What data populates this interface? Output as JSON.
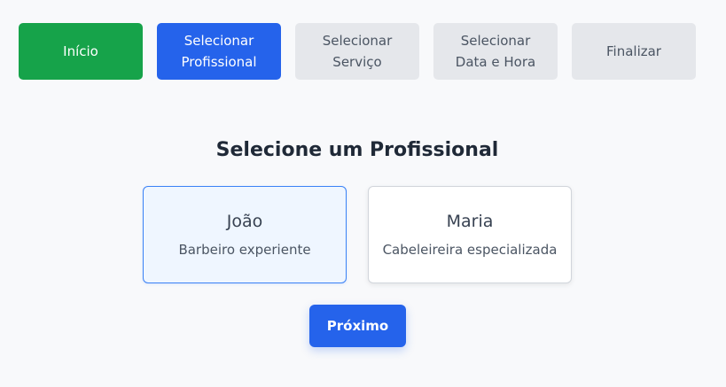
{
  "steps": [
    {
      "label": "Início",
      "state": "done"
    },
    {
      "label": "Selecionar\nProfissional",
      "state": "active"
    },
    {
      "label": "Selecionar\nServiço",
      "state": "pending"
    },
    {
      "label": "Selecionar\nData e Hora",
      "state": "pending"
    },
    {
      "label": "Finalizar",
      "state": "pending"
    }
  ],
  "page_title": "Selecione um Profissional",
  "professionals": [
    {
      "name": "João",
      "description": "Barbeiro experiente",
      "selected": true
    },
    {
      "name": "Maria",
      "description": "Cabeleireira especializada",
      "selected": false
    }
  ],
  "next_button_label": "Próximo",
  "colors": {
    "done": "#16a34a",
    "active": "#2563eb",
    "pending": "#e5e7eb",
    "selected_card_bg": "#eff6ff",
    "selected_card_border": "#3b82f6"
  }
}
